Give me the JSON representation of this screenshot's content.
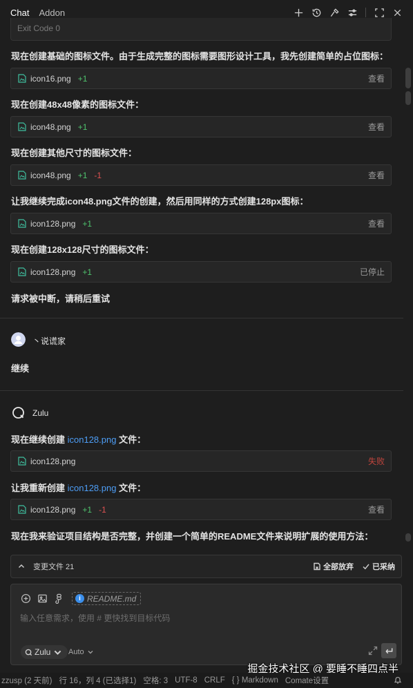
{
  "header": {
    "tabs": [
      {
        "label": "Chat",
        "active": true
      },
      {
        "label": "Addon",
        "active": false
      }
    ],
    "icons": [
      "plus-icon",
      "history-icon",
      "tools-icon",
      "settings-sliders-icon",
      "fullscreen-icon",
      "close-icon"
    ]
  },
  "chat": {
    "exit_code": "Exit Code 0",
    "messages": [
      "现在创建基础的图标文件。由于生成完整的图标需要图形设计工具，我先创建简单的占位图标：",
      "现在创建48x48像素的图标文件：",
      "现在创建其他尺寸的图标文件：",
      "让我继续完成icon48.png文件的创建，然后用同样的方式创建128px图标：",
      "现在创建128x128尺寸的图标文件："
    ],
    "files": [
      {
        "name": "icon16.png",
        "plus": "+1",
        "minus": "",
        "action": "查看"
      },
      {
        "name": "icon48.png",
        "plus": "+1",
        "minus": "",
        "action": "查看"
      },
      {
        "name": "icon48.png",
        "plus": "+1",
        "minus": "-1",
        "action": "查看"
      },
      {
        "name": "icon128.png",
        "plus": "+1",
        "minus": "",
        "action": "查看"
      },
      {
        "name": "icon128.png",
        "plus": "+1",
        "minus": "",
        "action": "已停止"
      }
    ],
    "interrupted": "请求被中断，请稍后重试",
    "user": {
      "name": "丶说谎家",
      "message": "继续"
    },
    "assistant": {
      "name": "Zulu",
      "msg1_pre": "现在继续创建 ",
      "msg1_link": "icon128.png",
      "msg1_post": " 文件：",
      "file1": {
        "name": "icon128.png",
        "action": "失败"
      },
      "msg2_pre": "让我重新创建 ",
      "msg2_link": "icon128.png",
      "msg2_post": " 文件：",
      "file2": {
        "name": "icon128.png",
        "plus": "+1",
        "minus": "-1",
        "action": "查看"
      },
      "msg3": "现在我来验证项目结构是否完整，并创建一个简单的README文件来说明扩展的使用方法："
    }
  },
  "changes": {
    "label": "变更文件 21",
    "discard_all": "全部放弃",
    "accept_all": "已采纳"
  },
  "input": {
    "chip": "README.md",
    "placeholder": "输入任意需求，使用 # 更快找到目标代码",
    "model": "Zulu",
    "mode": "Auto"
  },
  "statusbar": {
    "items": [
      "zzusp (2 天前)",
      "行 16，列 4 (已选择1)",
      "空格: 3",
      "UTF-8",
      "CRLF",
      "{ } Markdown",
      "Comate设置"
    ]
  },
  "watermark": "掘金技术社区 @ 要睡不睡四点半",
  "colors": {
    "background": "#1e1e1e",
    "link": "#4d9df5",
    "added": "#4fc36d",
    "removed": "#e05252",
    "failed": "#c0453d"
  }
}
